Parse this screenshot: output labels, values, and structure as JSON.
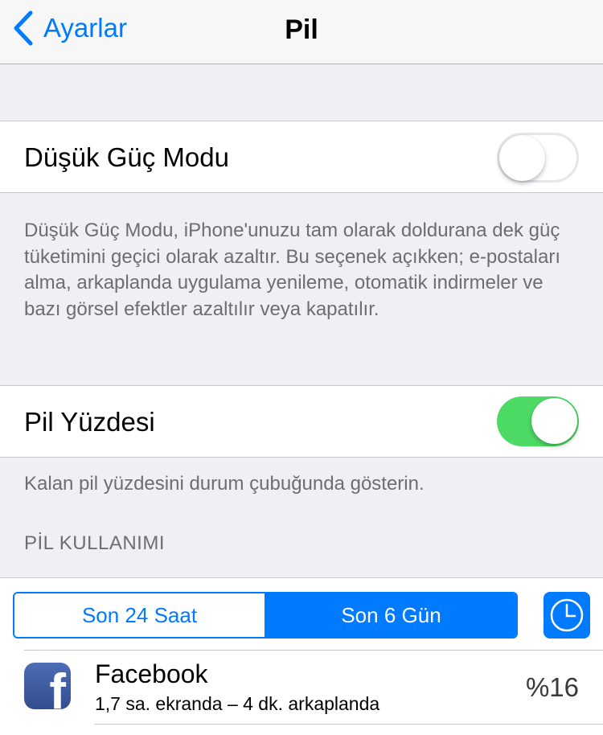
{
  "nav": {
    "back_label": "Ayarlar",
    "title": "Pil"
  },
  "low_power": {
    "label": "Düşük Güç Modu",
    "enabled": false,
    "description": "Düşük Güç Modu, iPhone'unuzu tam olarak doldurana dek güç tüketimini geçici olarak azaltır. Bu seçenek açıkken; e-postaları alma, arkaplanda uygulama yenileme, otomatik indirmeler ve bazı görsel efektler azaltılır veya kapatılır."
  },
  "battery_percentage": {
    "label": "Pil Yüzdesi",
    "enabled": true,
    "description": "Kalan pil yüzdesini durum çubuğunda gösterin."
  },
  "usage": {
    "header": "PİL KULLANIMI",
    "segments": [
      "Son 24 Saat",
      "Son 6 Gün"
    ],
    "selected_segment": "Son 6 Gün",
    "clock_icon": "clock-icon",
    "apps": [
      {
        "name": "Facebook",
        "detail": "1,7 sa. ekranda – 4 dk. arkaplanda",
        "percent": "%16",
        "icon": "facebook-icon"
      }
    ]
  },
  "colors": {
    "accent": "#007aff",
    "toggle_on": "#4cd964",
    "background": "#efeff4",
    "secondary_text": "#6d6d72"
  }
}
